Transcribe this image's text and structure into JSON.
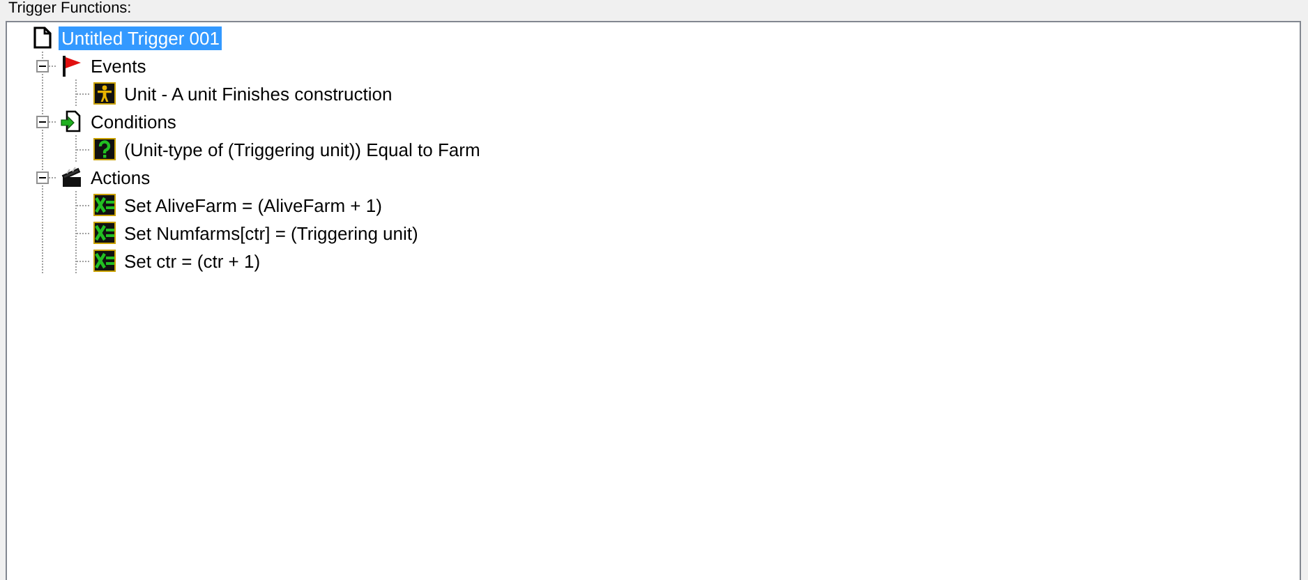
{
  "panel": {
    "label": "Trigger Functions:"
  },
  "tree": [
    {
      "kind": "trigger",
      "label": "Untitled Trigger 001",
      "selected": true,
      "children": [
        {
          "kind": "events",
          "label": "Events",
          "selected": false,
          "expanded": true,
          "children": [
            {
              "kind": "event",
              "label": "Unit - A unit Finishes construction",
              "selected": false
            }
          ]
        },
        {
          "kind": "conditions",
          "label": "Conditions",
          "selected": false,
          "expanded": true,
          "children": [
            {
              "kind": "condition",
              "label": "(Unit-type of (Triggering unit)) Equal to Farm",
              "selected": false
            }
          ]
        },
        {
          "kind": "actions",
          "label": "Actions",
          "selected": false,
          "expanded": true,
          "children": [
            {
              "kind": "action",
              "label": "Set AliveFarm = (AliveFarm + 1)",
              "selected": false
            },
            {
              "kind": "action",
              "label": "Set Numfarms[ctr] = (Triggering unit)",
              "selected": false
            },
            {
              "kind": "action",
              "label": "Set ctr = (ctr + 1)",
              "selected": false
            }
          ]
        }
      ]
    }
  ]
}
